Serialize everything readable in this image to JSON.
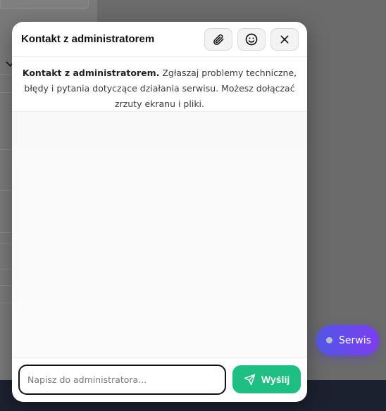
{
  "modal": {
    "title": "Kontakt z administratorem",
    "info_bold": "Kontakt z administratorem.",
    "info_text": " Zgłaszaj problemy techniczne, błędy i pytania dotyczące działania serwisu. Możesz dołączać zrzuty ekranu i pliki.",
    "input_placeholder": "Napisz do administratora...",
    "input_value": "",
    "send_label": "Wyślij"
  },
  "header_icons": [
    "paperclip-icon",
    "smiley-icon",
    "close-icon"
  ],
  "fab": {
    "label": "Serwis"
  },
  "colors": {
    "send_button": "#1fbf83",
    "fab_gradient_start": "#5156e6",
    "fab_gradient_end": "#7d3df0"
  }
}
